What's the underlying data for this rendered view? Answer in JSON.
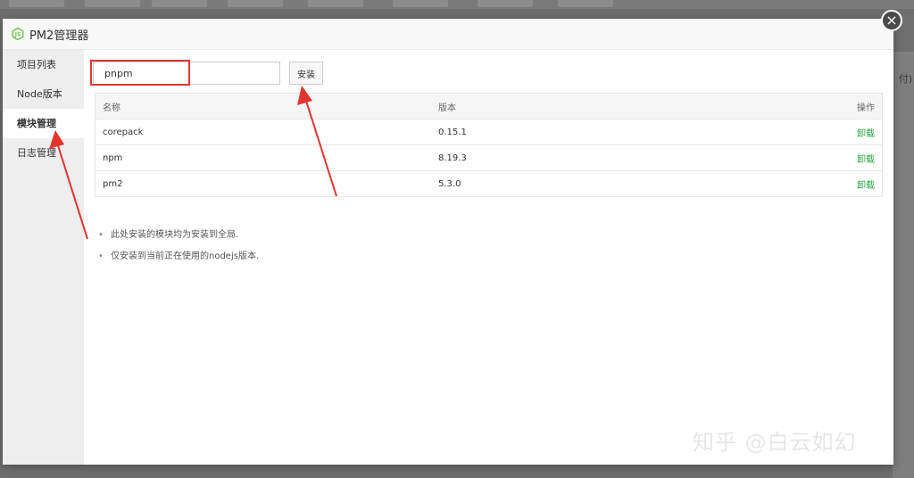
{
  "window": {
    "title": "PM2管理器",
    "close_glyph": "×",
    "logo_icon": "nodejs-icon"
  },
  "sidebar": {
    "items": [
      {
        "label": "项目列表"
      },
      {
        "label": "Node版本"
      },
      {
        "label": "模块管理"
      },
      {
        "label": "日志管理"
      }
    ],
    "active_index": 2
  },
  "install": {
    "input_value": "pnpm",
    "button_label": "安装"
  },
  "table": {
    "headers": {
      "name": "名称",
      "version": "版本",
      "ops": "操作"
    },
    "rows": [
      {
        "name": "corepack",
        "version": "0.15.1",
        "action": "卸载"
      },
      {
        "name": "npm",
        "version": "8.19.3",
        "action": "卸载"
      },
      {
        "name": "pm2",
        "version": "5.3.0",
        "action": "卸载"
      }
    ]
  },
  "tips": [
    "此处安装的模块均为安装到全局.",
    "仅安装到当前正在使用的nodejs版本."
  ],
  "background": {
    "right_fragment": "付)"
  },
  "watermark": "知乎 @白云如幻",
  "colors": {
    "accent_green": "#20a53a",
    "annotation_red": "#e0342e",
    "overlay": "#6f6f6f"
  }
}
